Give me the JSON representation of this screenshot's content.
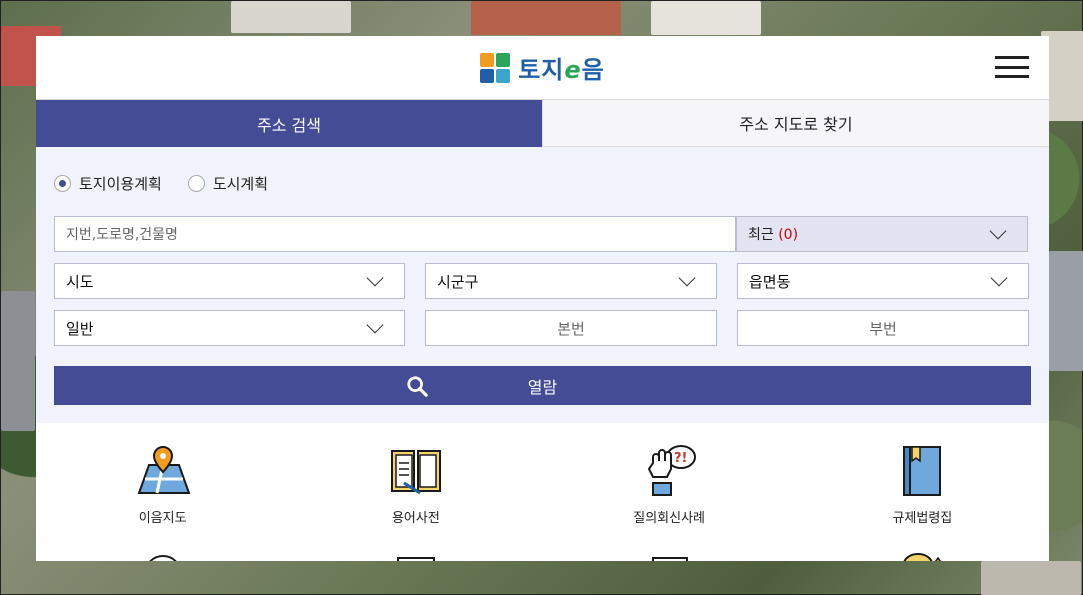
{
  "header": {
    "logo_text": "토지",
    "logo_e": "e",
    "logo_tail": "음"
  },
  "tabs": [
    {
      "label": "주소 검색",
      "active": true
    },
    {
      "label": "주소 지도로 찾기",
      "active": false
    }
  ],
  "search": {
    "radios": [
      {
        "label": "토지이용계획",
        "checked": true
      },
      {
        "label": "도시계획",
        "checked": false
      }
    ],
    "placeholder": "지번,도로명,건물명",
    "recent_label": "최근",
    "recent_count": "(0)",
    "selects": [
      "시도",
      "시군구",
      "읍면동",
      "일반"
    ],
    "main_no_placeholder": "본번",
    "sub_no_placeholder": "부번",
    "view_button": "열람"
  },
  "menu": [
    {
      "label": "이음지도",
      "icon": "map-pin-icon"
    },
    {
      "label": "용어사전",
      "icon": "book-icon"
    },
    {
      "label": "질의회신사례",
      "icon": "question-hand-icon"
    },
    {
      "label": "규제법령집",
      "icon": "law-book-icon"
    }
  ],
  "colors": {
    "accent": "#434c95",
    "recent_count": "#d00000",
    "search_bg": "#f0f3fb"
  }
}
